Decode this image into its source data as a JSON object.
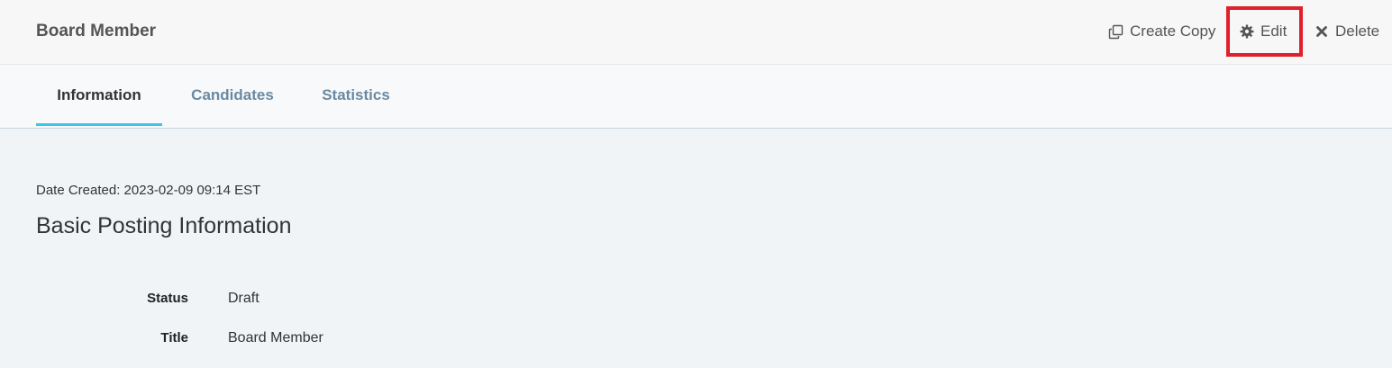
{
  "header": {
    "title": "Board Member",
    "actions": {
      "create_copy": "Create Copy",
      "edit": "Edit",
      "delete": "Delete"
    },
    "icons": {
      "create_copy": "copy-icon",
      "edit": "gear-icon",
      "delete": "close-icon"
    },
    "highlight_color": "#e0202a"
  },
  "tabs": [
    {
      "label": "Information",
      "active": true
    },
    {
      "label": "Candidates",
      "active": false
    },
    {
      "label": "Statistics",
      "active": false
    }
  ],
  "main": {
    "date_created": "Date Created: 2023-02-09 09:14 EST",
    "section_title": "Basic Posting Information",
    "fields": [
      {
        "label": "Status",
        "value": "Draft"
      },
      {
        "label": "Title",
        "value": "Board Member"
      }
    ]
  },
  "colors": {
    "accent_tab_underline": "#3cc6e6",
    "inactive_tab": "#6a8aa3",
    "background": "#f0f4f7"
  }
}
